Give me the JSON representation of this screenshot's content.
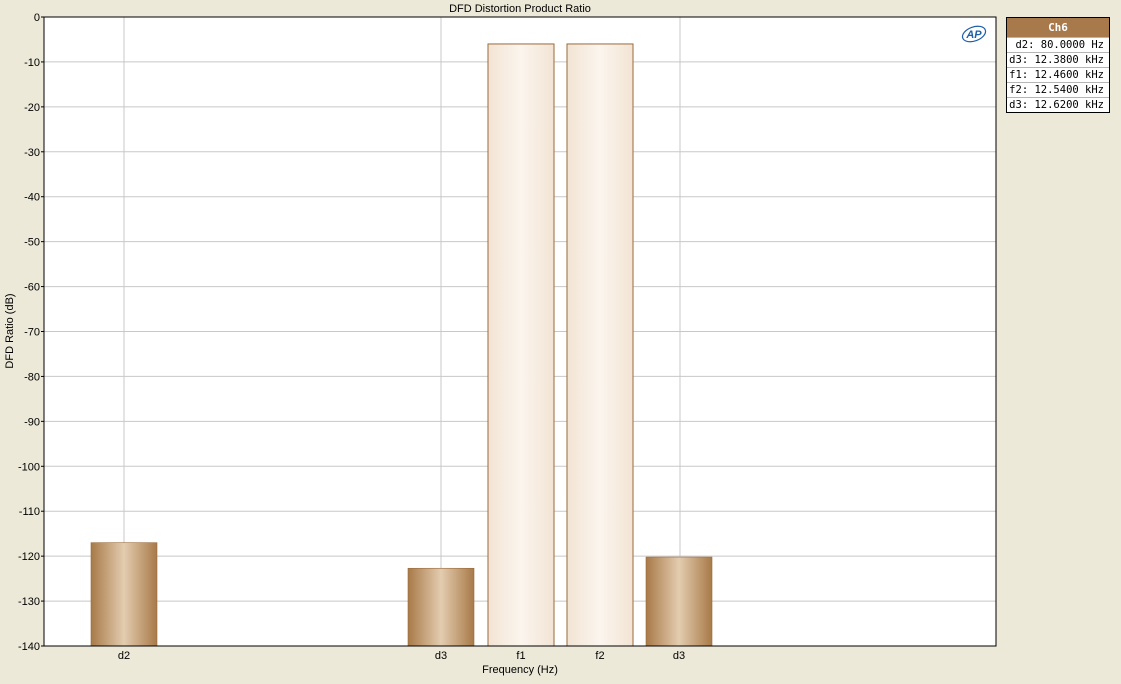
{
  "chart_data": {
    "type": "bar",
    "title": "DFD Distortion Product Ratio",
    "xlabel": "Frequency (Hz)",
    "ylabel": "DFD Ratio (dB)",
    "ylim": [
      -140,
      0
    ],
    "yticks": [
      0,
      -10,
      -20,
      -30,
      -40,
      -50,
      -60,
      -70,
      -80,
      -90,
      -100,
      -110,
      -120,
      -130,
      -140
    ],
    "grid": true,
    "categories": [
      "d2",
      "d3",
      "f1",
      "f2",
      "d3"
    ],
    "series": [
      {
        "values": [
          -117,
          -122.7,
          -6,
          -6,
          -120.2
        ],
        "kinds": [
          "product",
          "product",
          "fundamental",
          "fundamental",
          "product"
        ]
      }
    ]
  },
  "legend": {
    "channel": "Ch6",
    "entries": [
      "d2: 80.0000 Hz",
      "d3: 12.3800 kHz",
      "f1: 12.4600 kHz",
      "f2: 12.5400 kHz",
      "d3: 12.6200 kHz"
    ]
  },
  "logo": {
    "text": "AP",
    "color": "#1f5fa8"
  },
  "colors": {
    "product_bar": "#b8905f",
    "fundamental_bar": "#f7ece0",
    "bar_outline": "#9a6a3a",
    "grid": "#c8c8c8",
    "plot_background": "#ffffff",
    "page_background": "#ece9d8"
  }
}
